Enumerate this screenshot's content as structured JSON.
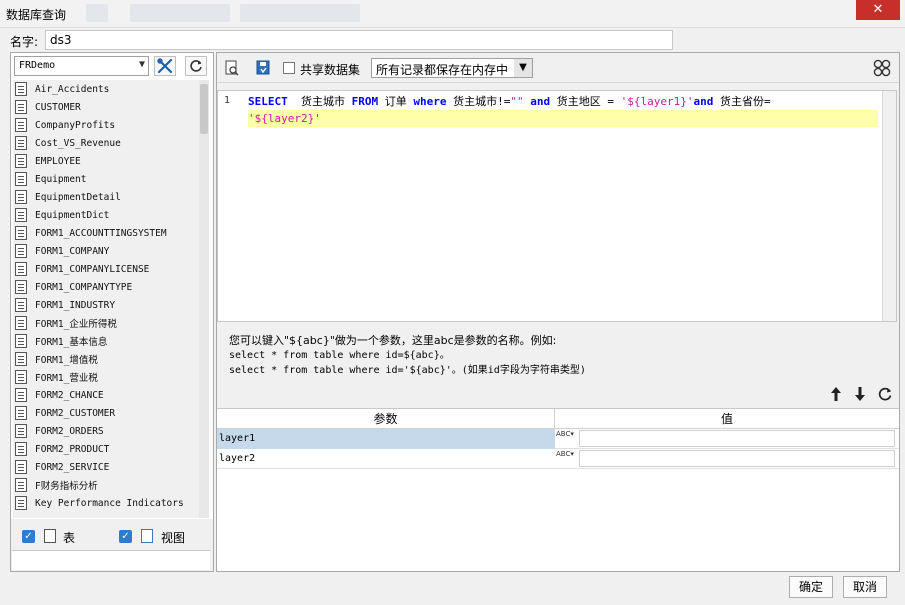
{
  "window": {
    "title": "数据库查询",
    "close_glyph": "✕"
  },
  "name_field": {
    "label": "名字:",
    "value": "ds3"
  },
  "db": {
    "selected": "FRDemo",
    "tables": [
      "Air_Accidents",
      "CUSTOMER",
      "CompanyProfits",
      "Cost_VS_Revenue",
      "EMPLOYEE",
      "Equipment",
      "EquipmentDetail",
      "EquipmentDict",
      "FORM1_ACCOUNTTINGSYSTEM",
      "FORM1_COMPANY",
      "FORM1_COMPANYLICENSE",
      "FORM1_COMPANYTYPE",
      "FORM1_INDUSTRY",
      "FORM1_企业所得税",
      "FORM1_基本信息",
      "FORM1_增值税",
      "FORM1_营业税",
      "FORM2_CHANCE",
      "FORM2_CUSTOMER",
      "FORM2_ORDERS",
      "FORM2_PRODUCT",
      "FORM2_SERVICE",
      "F财务指标分析",
      "Key Performance Indicators"
    ],
    "filter_table_label": "表",
    "filter_view_label": "视图"
  },
  "toolbar": {
    "share_label": "共享数据集",
    "memory_mode": "所有记录都保存在内存中"
  },
  "sql": {
    "line_number": "1",
    "line1": {
      "k1": "SELECT",
      "t1": "  货主城市 ",
      "k2": "FROM",
      "t2": " 订单 ",
      "k3": "where",
      "t3": " 货主城市!=",
      "s1": "\"\"",
      "t4": " ",
      "k4": "and",
      "t5": " 货主地区 = ",
      "s2": "'${layer1}'",
      "k5": "and",
      "t6": " 货主省份="
    },
    "line2": {
      "s3": "'${layer2}'"
    }
  },
  "hint": {
    "line1": "您可以键入\"${abc}\"做为一个参数，这里abc是参数的名称。例如:",
    "line2": "select * from table where id=${abc}。",
    "line3": "select * from table where id='${abc}'。(如果id字段为字符串类型)"
  },
  "params": {
    "col_name": "参数",
    "col_value": "值",
    "type_glyph": "ABC",
    "rows": [
      {
        "name": "layer1",
        "value": ""
      },
      {
        "name": "layer2",
        "value": ""
      }
    ]
  },
  "buttons": {
    "ok": "确定",
    "cancel": "取消"
  },
  "colors": {
    "keyword": "#0000ff",
    "string": "#c21ba3",
    "highlight": "#ffffaa",
    "selected_row": "#c5d9ea",
    "checkbox": "#2e7bd1"
  }
}
